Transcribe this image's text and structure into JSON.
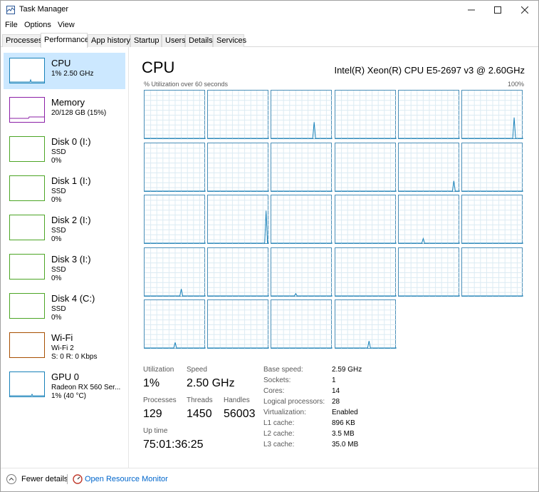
{
  "window": {
    "title": "Task Manager"
  },
  "menu": [
    "File",
    "Options",
    "View"
  ],
  "tabs": [
    "Processes",
    "Performance",
    "App history",
    "Startup",
    "Users",
    "Details",
    "Services"
  ],
  "active_tab": "Performance",
  "sidebar": [
    {
      "title": "CPU",
      "sub1": "1% 2.50 GHz",
      "sub2": "",
      "color": "#1781b9",
      "kind": "cpu"
    },
    {
      "title": "Memory",
      "sub1": "20/128 GB (15%)",
      "sub2": "",
      "color": "#8b1fa6",
      "kind": "mem"
    },
    {
      "title": "Disk 0 (I:)",
      "sub1": "SSD",
      "sub2": "0%",
      "color": "#4ca525",
      "kind": "disk"
    },
    {
      "title": "Disk 1 (I:)",
      "sub1": "SSD",
      "sub2": "0%",
      "color": "#4ca525",
      "kind": "disk"
    },
    {
      "title": "Disk 2 (I:)",
      "sub1": "SSD",
      "sub2": "0%",
      "color": "#4ca525",
      "kind": "disk"
    },
    {
      "title": "Disk 3 (I:)",
      "sub1": "SSD",
      "sub2": "0%",
      "color": "#4ca525",
      "kind": "disk"
    },
    {
      "title": "Disk 4 (C:)",
      "sub1": "SSD",
      "sub2": "0%",
      "color": "#4ca525",
      "kind": "disk"
    },
    {
      "title": "Wi-Fi",
      "sub1": "Wi-Fi 2",
      "sub2": "S: 0 R: 0 Kbps",
      "color": "#a74f01",
      "kind": "wifi"
    },
    {
      "title": "GPU 0",
      "sub1": "Radeon RX 560 Ser...",
      "sub2": "1% (40 °C)",
      "color": "#1781b9",
      "kind": "gpu"
    }
  ],
  "main": {
    "title": "CPU",
    "model": "Intel(R) Xeon(R) CPU E5-2697 v3 @ 2.60GHz",
    "graph_label": "% Utilization over 60 seconds",
    "graph_max": "100%",
    "core_count": 28,
    "core_spikes": [
      [],
      [],
      [
        0.7,
        0.35
      ],
      [],
      [],
      [
        0.85,
        0.45
      ],
      [],
      [],
      [],
      [],
      [
        0.9,
        0.22
      ],
      [],
      [],
      [
        0.95,
        0.7
      ],
      [],
      [],
      [
        0.4,
        0.1
      ],
      [],
      [
        0.6,
        0.15
      ],
      [],
      [
        0.4,
        0.05
      ],
      [],
      [],
      [],
      [
        0.5,
        0.12
      ],
      [],
      [],
      [
        0.55,
        0.15
      ]
    ],
    "stats": {
      "utilization_label": "Utilization",
      "utilization": "1%",
      "speed_label": "Speed",
      "speed": "2.50 GHz",
      "processes_label": "Processes",
      "processes": "129",
      "threads_label": "Threads",
      "threads": "1450",
      "handles_label": "Handles",
      "handles": "56003",
      "uptime_label": "Up time",
      "uptime": "75:01:36:25"
    },
    "info": [
      {
        "label": "Base speed:",
        "value": "2.59 GHz"
      },
      {
        "label": "Sockets:",
        "value": "1"
      },
      {
        "label": "Cores:",
        "value": "14"
      },
      {
        "label": "Logical processors:",
        "value": "28"
      },
      {
        "label": "Virtualization:",
        "value": "Enabled"
      },
      {
        "label": "L1 cache:",
        "value": "896 KB"
      },
      {
        "label": "L2 cache:",
        "value": "3.5 MB"
      },
      {
        "label": "L3 cache:",
        "value": "35.0 MB"
      }
    ]
  },
  "footer": {
    "fewer_details": "Fewer details",
    "resource_monitor": "Open Resource Monitor"
  },
  "colors": {
    "accent": "#1781b9",
    "link": "#0066cc",
    "selected_bg": "#cce8ff"
  }
}
